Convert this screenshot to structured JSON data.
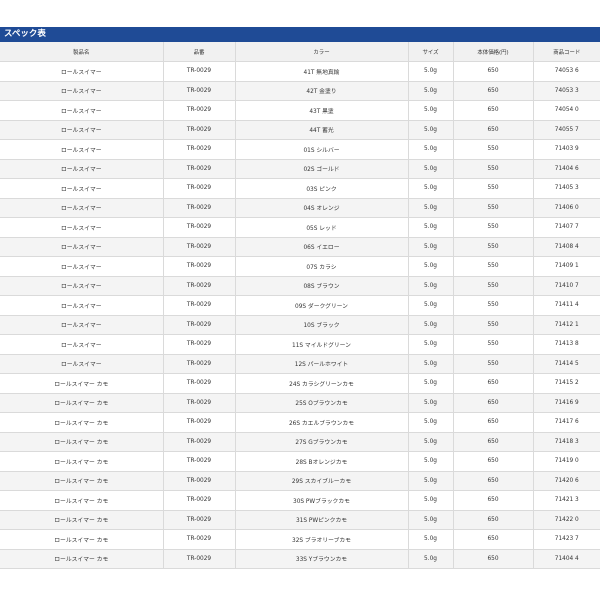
{
  "title": "スペック表",
  "columns": [
    "製品名",
    "品番",
    "カラー",
    "サイズ",
    "本体価格(円)",
    "商品コード"
  ],
  "rows": [
    [
      "ロールスイマー",
      "TR-0029",
      "41T 無地真鍮",
      "5.0g",
      "650",
      "74053 6"
    ],
    [
      "ロールスイマー",
      "TR-0029",
      "42T 金塗り",
      "5.0g",
      "650",
      "74053 3"
    ],
    [
      "ロールスイマー",
      "TR-0029",
      "43T 黒塗",
      "5.0g",
      "650",
      "74054 0"
    ],
    [
      "ロールスイマー",
      "TR-0029",
      "44T 蓄光",
      "5.0g",
      "650",
      "74055 7"
    ],
    [
      "ロールスイマー",
      "TR-0029",
      "01S シルバー",
      "5.0g",
      "550",
      "71403 9"
    ],
    [
      "ロールスイマー",
      "TR-0029",
      "02S ゴールド",
      "5.0g",
      "550",
      "71404 6"
    ],
    [
      "ロールスイマー",
      "TR-0029",
      "03S ピンク",
      "5.0g",
      "550",
      "71405 3"
    ],
    [
      "ロールスイマー",
      "TR-0029",
      "04S オレンジ",
      "5.0g",
      "550",
      "71406 0"
    ],
    [
      "ロールスイマー",
      "TR-0029",
      "05S レッド",
      "5.0g",
      "550",
      "71407 7"
    ],
    [
      "ロールスイマー",
      "TR-0029",
      "06S イエロー",
      "5.0g",
      "550",
      "71408 4"
    ],
    [
      "ロールスイマー",
      "TR-0029",
      "07S カラシ",
      "5.0g",
      "550",
      "71409 1"
    ],
    [
      "ロールスイマー",
      "TR-0029",
      "08S ブラウン",
      "5.0g",
      "550",
      "71410 7"
    ],
    [
      "ロールスイマー",
      "TR-0029",
      "09S ダークグリーン",
      "5.0g",
      "550",
      "71411 4"
    ],
    [
      "ロールスイマー",
      "TR-0029",
      "10S ブラック",
      "5.0g",
      "550",
      "71412 1"
    ],
    [
      "ロールスイマー",
      "TR-0029",
      "11S マイルドグリーン",
      "5.0g",
      "550",
      "71413 8"
    ],
    [
      "ロールスイマー",
      "TR-0029",
      "12S パールホワイト",
      "5.0g",
      "550",
      "71414 5"
    ],
    [
      "ロールスイマー カモ",
      "TR-0029",
      "24S カラシグリーンカモ",
      "5.0g",
      "650",
      "71415 2"
    ],
    [
      "ロールスイマー カモ",
      "TR-0029",
      "25S Oブラウンカモ",
      "5.0g",
      "650",
      "71416 9"
    ],
    [
      "ロールスイマー カモ",
      "TR-0029",
      "26S カエルブラウンカモ",
      "5.0g",
      "650",
      "71417 6"
    ],
    [
      "ロールスイマー カモ",
      "TR-0029",
      "27S Gブラウンカモ",
      "5.0g",
      "650",
      "71418 3"
    ],
    [
      "ロールスイマー カモ",
      "TR-0029",
      "28S Bオレンジカモ",
      "5.0g",
      "650",
      "71419 0"
    ],
    [
      "ロールスイマー カモ",
      "TR-0029",
      "29S スカイブルーカモ",
      "5.0g",
      "650",
      "71420 6"
    ],
    [
      "ロールスイマー カモ",
      "TR-0029",
      "30S PWブラックカモ",
      "5.0g",
      "650",
      "71421 3"
    ],
    [
      "ロールスイマー カモ",
      "TR-0029",
      "31S PWピンクカモ",
      "5.0g",
      "650",
      "71422 0"
    ],
    [
      "ロールスイマー カモ",
      "TR-0029",
      "32S ブラオリーブカモ",
      "5.0g",
      "650",
      "71423 7"
    ],
    [
      "ロールスイマー カモ",
      "TR-0029",
      "33S Yブラウンカモ",
      "5.0g",
      "650",
      "71404 4"
    ]
  ]
}
